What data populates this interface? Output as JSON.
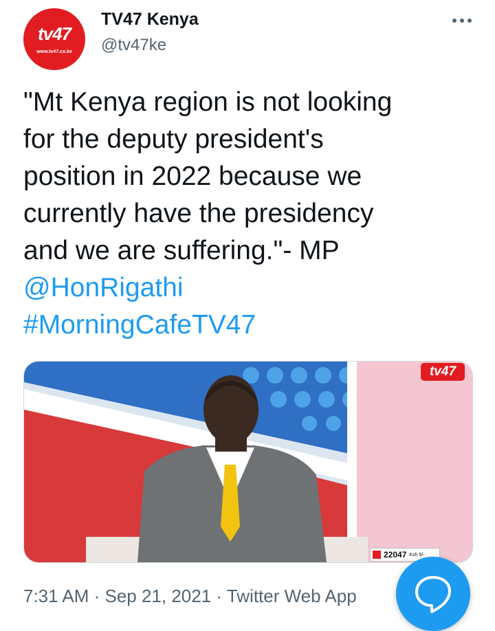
{
  "author": {
    "avatar_text": "tv47",
    "avatar_url_text": "www.tv47.co.ke",
    "display_name": "TV47 Kenya",
    "handle": "@tv47ke"
  },
  "tweet": {
    "lines": [
      "\"Mt Kenya region is not looking",
      "for the deputy president's",
      "position in 2022 because we",
      "currently have the presidency",
      "and we are suffering.\"- MP"
    ],
    "mention": "@HonRigathi",
    "hashtag": "#MorningCafeTV47"
  },
  "media": {
    "logo_text": "tv47",
    "ticker_value": "22047",
    "ticker_small": "Ksh 5/-"
  },
  "meta": {
    "text": "7:31 AM · Sep 21, 2021 · Twitter Web App"
  },
  "colors": {
    "brand_red": "#e11d22",
    "twitter_blue": "#1d9bf0",
    "muted": "#536471"
  },
  "icons": {
    "more": "more-horizontal-icon",
    "compose": "reply-bubble-icon"
  }
}
